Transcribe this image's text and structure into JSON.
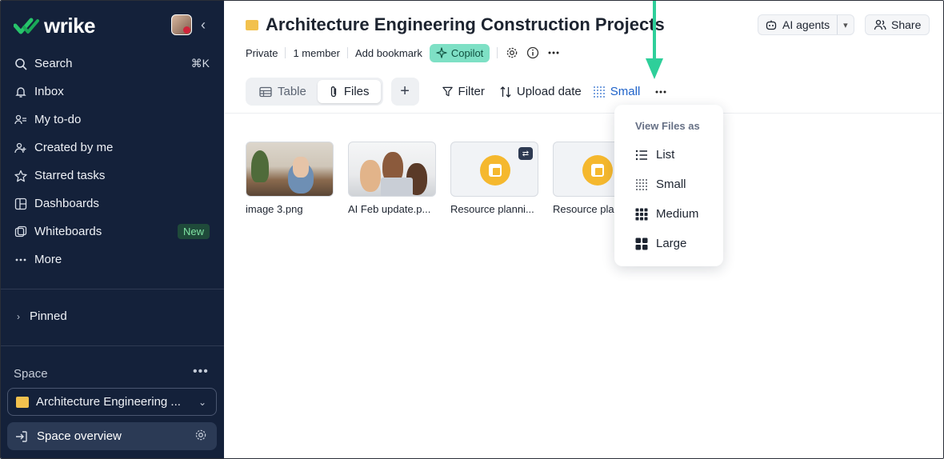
{
  "brand": {
    "name": "wrike",
    "accent": "#27c46b"
  },
  "sidebar": {
    "items": [
      {
        "label": "Search",
        "icon": "search-icon",
        "shortcut": "⌘K"
      },
      {
        "label": "Inbox",
        "icon": "bell-icon"
      },
      {
        "label": "My to-do",
        "icon": "person-list-icon"
      },
      {
        "label": "Created by me",
        "icon": "person-add-icon"
      },
      {
        "label": "Starred tasks",
        "icon": "star-icon"
      },
      {
        "label": "Dashboards",
        "icon": "dashboard-icon"
      },
      {
        "label": "Whiteboards",
        "icon": "whiteboard-icon",
        "badge": "New"
      },
      {
        "label": "More",
        "icon": "more-dots-icon"
      }
    ],
    "pinned_label": "Pinned",
    "space_label": "Space",
    "space_select": "Architecture Engineering ...",
    "space_overview": "Space overview"
  },
  "header": {
    "title": "Architecture Engineering Construction Projects",
    "ai_agents": "AI agents",
    "share": "Share",
    "meta": {
      "privacy": "Private",
      "members": "1 member",
      "bookmark": "Add bookmark",
      "copilot": "Copilot"
    }
  },
  "toolbar": {
    "tabs": [
      {
        "label": "Table"
      },
      {
        "label": "Files"
      }
    ],
    "filter": "Filter",
    "sort": "Upload date",
    "view": "Small"
  },
  "files": [
    {
      "name": "image 3.png"
    },
    {
      "name": "AI Feb update.p..."
    },
    {
      "name": "Resource planni..."
    },
    {
      "name": "Resource pla"
    }
  ],
  "dropdown": {
    "header": "View Files as",
    "options": [
      "List",
      "Small",
      "Medium",
      "Large"
    ]
  },
  "colors": {
    "sidebar_bg": "#14213a",
    "copilot_bg": "#7ee0c5",
    "annotation_arrow": "#2ecf9a",
    "view_accent": "#1e62c9"
  }
}
